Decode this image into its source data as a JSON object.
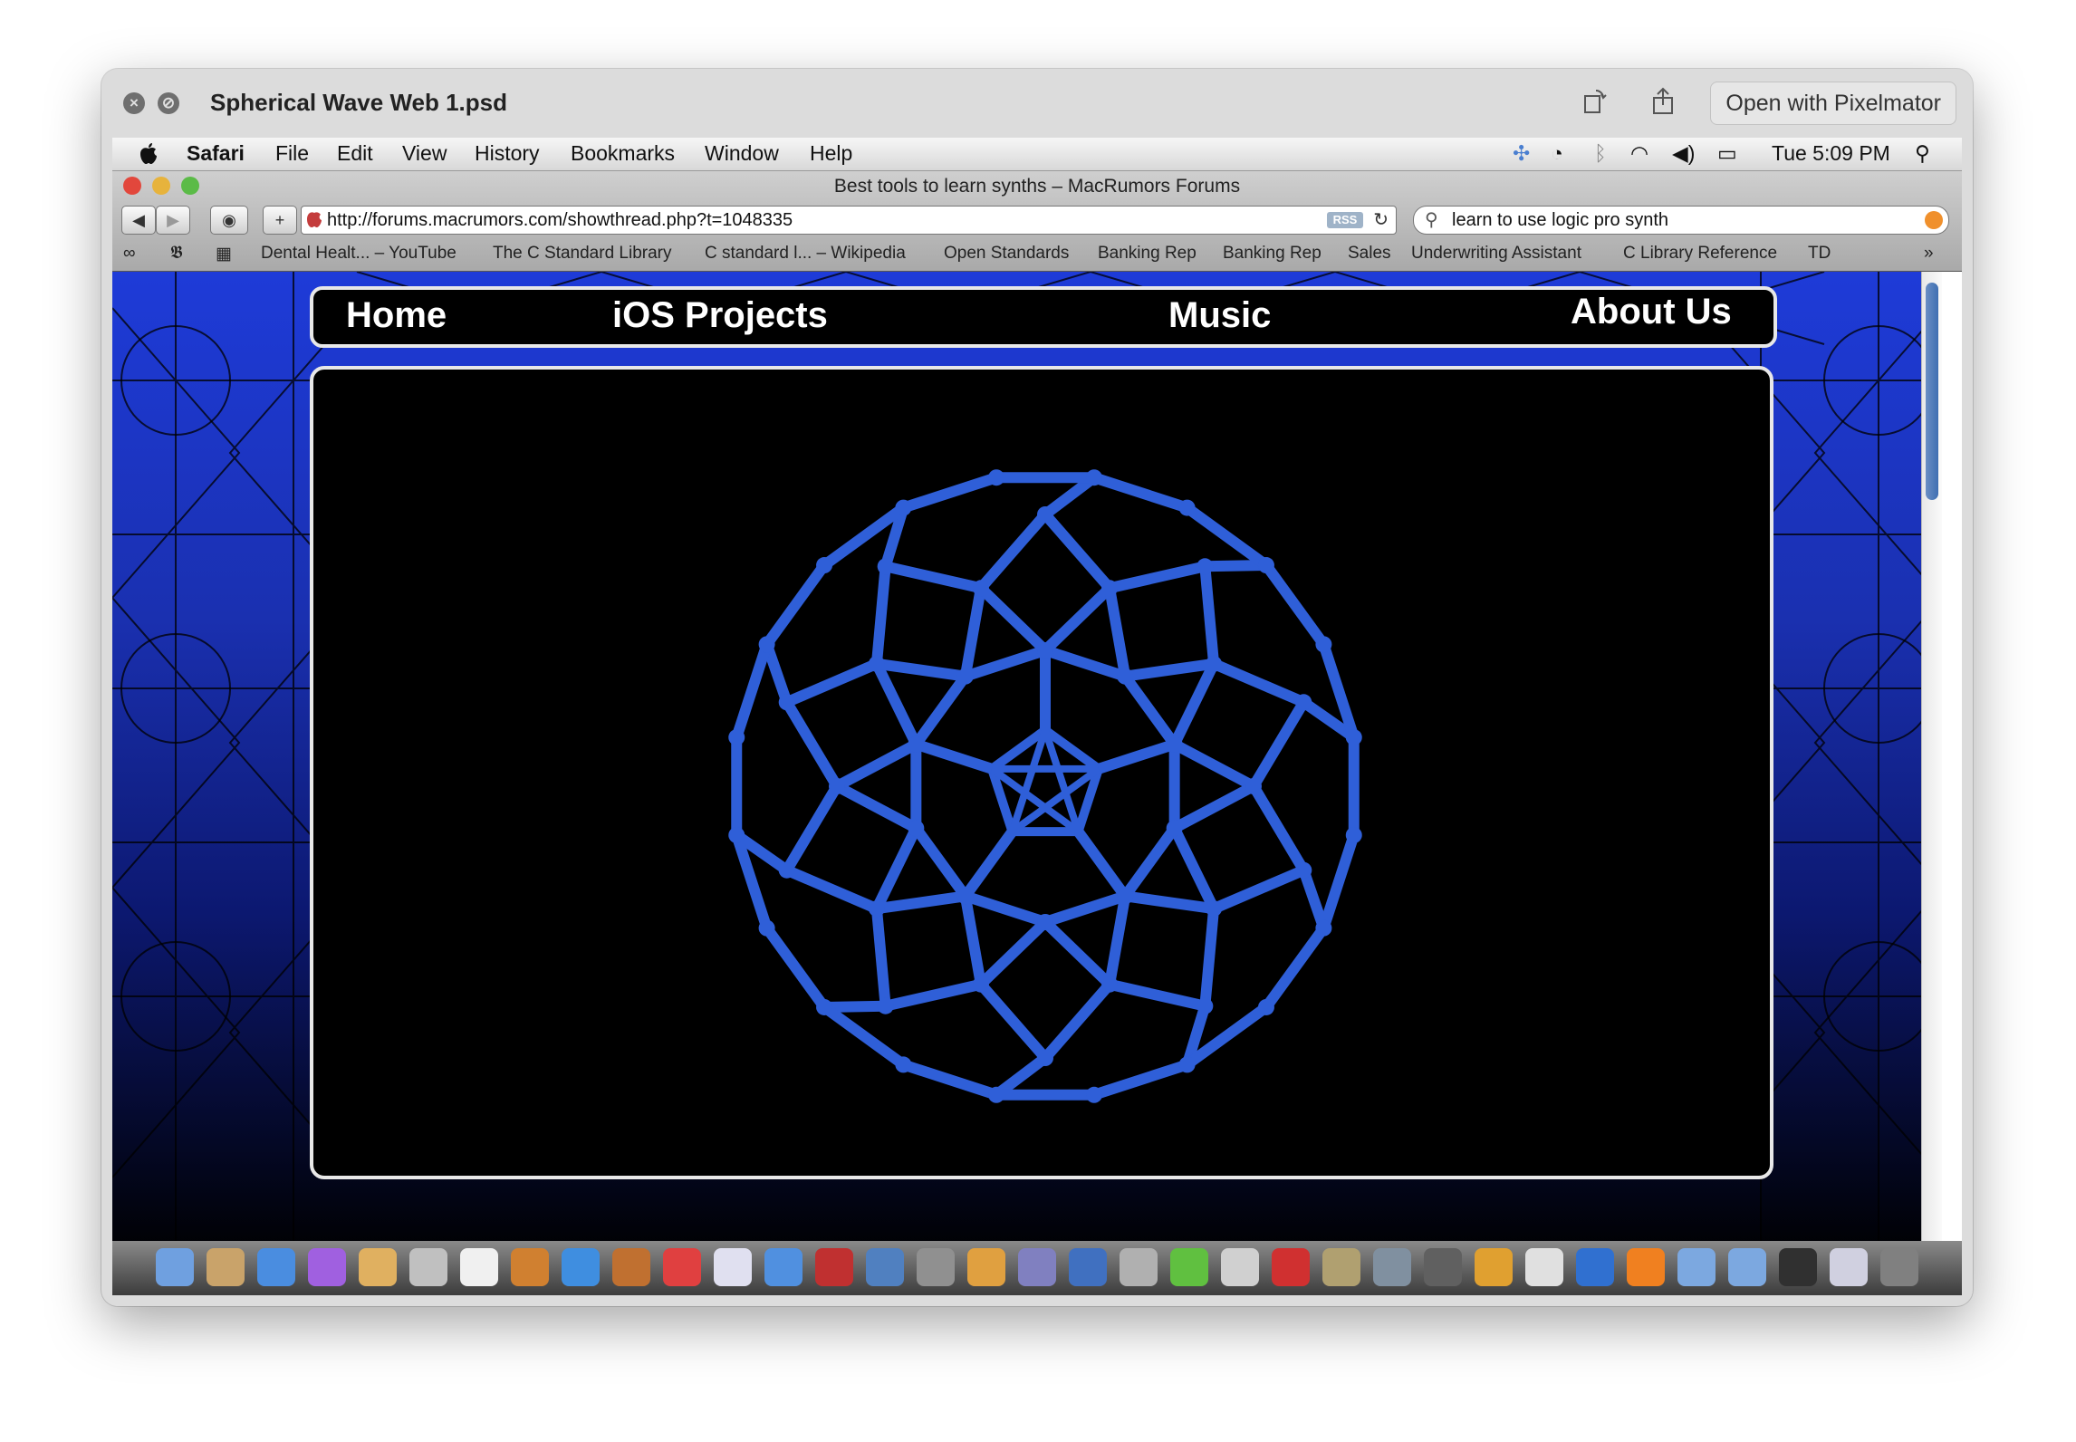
{
  "window": {
    "title": "Spherical Wave Web 1.psd",
    "open_button": "Open with Pixelmator"
  },
  "menubar": {
    "app": "Safari",
    "items": [
      "File",
      "Edit",
      "View",
      "History",
      "Bookmarks",
      "Window",
      "Help"
    ],
    "clock": "Tue 5:09 PM"
  },
  "safari": {
    "title": "Best tools to learn synths – MacRumors Forums",
    "url": "http://forums.macrumors.com/showthread.php?t=1048335",
    "rss": "RSS",
    "search": "learn to use logic pro synth",
    "bookmarks": [
      "Dental Healt... – YouTube",
      "The C Standard Library",
      "C standard l... – Wikipedia",
      "Open Standards",
      "Banking Rep",
      "Banking Rep",
      "Sales",
      "Underwriting Assistant",
      "C Library Reference",
      "TD"
    ]
  },
  "page": {
    "nav": [
      "Home",
      "iOS Projects",
      "Music",
      "About Us"
    ],
    "accent": "#2f5fd8"
  }
}
